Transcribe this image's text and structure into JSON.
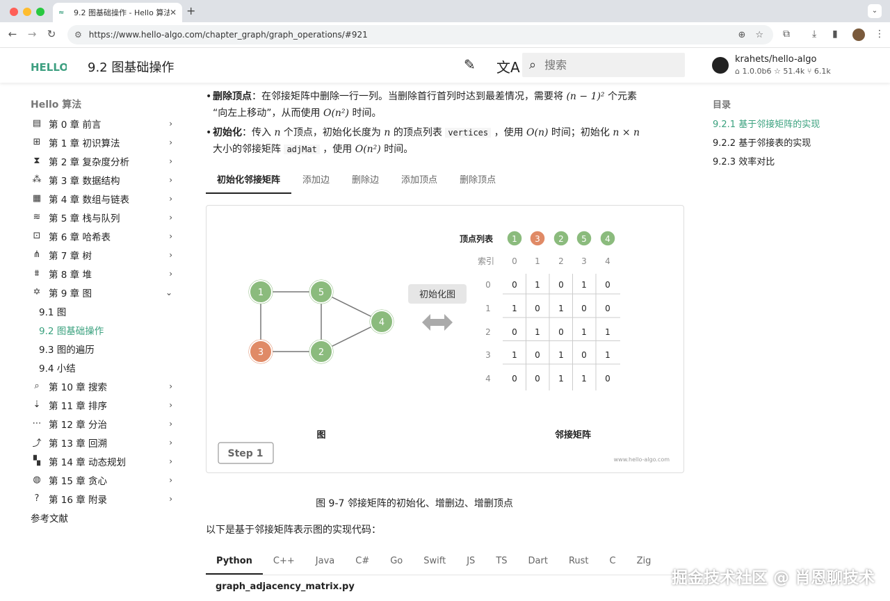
{
  "browser": {
    "tab_title": "9.2  图基础操作 - Hello 算法",
    "tab_close": "✕",
    "new_tab": "+",
    "url": "https://www.hello-algo.com/chapter_graph/graph_operations/#921"
  },
  "header": {
    "logo_text": "HELLO",
    "title": "9.2   图基础操作",
    "search_placeholder": "搜索",
    "repo_name": "krahets/hello-algo",
    "repo_version": "1.0.0b6",
    "repo_stars": "51.4k",
    "repo_forks": "6.1k"
  },
  "leftnav": {
    "heading": "Hello 算法",
    "chapters": [
      {
        "icon": "book-icon",
        "glyph": "▤",
        "label": "第 0 章   前言"
      },
      {
        "icon": "calculator-icon",
        "glyph": "⊞",
        "label": "第 1 章   初识算法"
      },
      {
        "icon": "hourglass-icon",
        "glyph": "⧗",
        "label": "第 2 章   复杂度分析"
      },
      {
        "icon": "shapes-icon",
        "glyph": "⁂",
        "label": "第 3 章   数据结构"
      },
      {
        "icon": "table-icon",
        "glyph": "▦",
        "label": "第 4 章   数组与链表"
      },
      {
        "icon": "stack-icon",
        "glyph": "≋",
        "label": "第 5 章   栈与队列"
      },
      {
        "icon": "hash-table-icon",
        "glyph": "⊡",
        "label": "第 6 章   哈希表"
      },
      {
        "icon": "tree-icon",
        "glyph": "⋔",
        "label": "第 7 章   树"
      },
      {
        "icon": "heap-icon",
        "glyph": "⩩",
        "label": "第 8 章   堆"
      },
      {
        "icon": "graph-icon",
        "glyph": "✡",
        "label": "第 9 章   图"
      }
    ],
    "sub_items": [
      "9.1   图",
      "9.2   图基础操作",
      "9.3   图的遍历",
      "9.4   小结"
    ],
    "chapters_after": [
      {
        "icon": "search-list-icon",
        "glyph": "⌕",
        "label": "第 10 章   搜索"
      },
      {
        "icon": "sort-icon",
        "glyph": "⇣",
        "label": "第 11 章   排序"
      },
      {
        "icon": "divide-icon",
        "glyph": "⋯",
        "label": "第 12 章   分治"
      },
      {
        "icon": "backtrack-icon",
        "glyph": "⤴",
        "label": "第 13 章   回溯"
      },
      {
        "icon": "grid-icon",
        "glyph": "▚",
        "label": "第 14 章   动态规划"
      },
      {
        "icon": "bulb-icon",
        "glyph": "◍",
        "label": "第 15 章   贪心"
      },
      {
        "icon": "question-icon",
        "glyph": "?",
        "label": "第 16 章   附录"
      }
    ],
    "references": "参考文献"
  },
  "toc": {
    "heading": "目录",
    "items": [
      "9.2.1   基于邻接矩阵的实现",
      "9.2.2   基于邻接表的实现",
      "9.2.3   效率对比"
    ]
  },
  "content": {
    "bullet1_label": "删除顶点",
    "bullet1_text1": "：在邻接矩阵中删除一行一列。当删除首行首列时达到最差情况，需要将 ",
    "bullet1_math1": "(n − 1)²",
    "bullet1_text2": " 个元素",
    "bullet1_text3": "“向左上移动”，从而使用 ",
    "bullet1_math2": "O(n²)",
    "bullet1_text4": " 时间。",
    "bullet2_label": "初始化",
    "bullet2_text1": "：传入 ",
    "bullet2_math1": "n",
    "bullet2_text2": " 个顶点，初始化长度为 ",
    "bullet2_math2": "n",
    "bullet2_text3": " 的顶点列表 ",
    "bullet2_code1": "vertices",
    "bullet2_text4": " ，使用 ",
    "bullet2_math3": "O(n)",
    "bullet2_text5": " 时间；初始化 ",
    "bullet2_math4": "n × n",
    "bullet2_text6": "大小的邻接矩阵 ",
    "bullet2_code2": "adjMat",
    "bullet2_text7": " ，使用 ",
    "bullet2_math5": "O(n²)",
    "bullet2_text8": " 时间。",
    "tabs": [
      "初始化邻接矩阵",
      "添加边",
      "删除边",
      "添加顶点",
      "删除顶点"
    ],
    "caption": "图 9-7    邻接矩阵的初始化、增删边、增删顶点",
    "para": "以下是基于邻接矩阵表示图的实现代码：",
    "code_tabs": [
      "Python",
      "C++",
      "Java",
      "C#",
      "Go",
      "Swift",
      "JS",
      "TS",
      "Dart",
      "Rust",
      "C",
      "Zig"
    ],
    "filename": "graph_adjacency_matrix.py"
  },
  "figure": {
    "vertex_list_label": "顶点列表",
    "index_label": "索引",
    "init_button": "初始化图",
    "graph_label": "图",
    "matrix_label": "邻接矩阵",
    "step_label": "Step 1",
    "site_mark": "www.hello-algo.com",
    "vertices": [
      "1",
      "3",
      "2",
      "5",
      "4"
    ],
    "vertex_colors": [
      "#8bbb7d",
      "#e08a66",
      "#8bbb7d",
      "#8bbb7d",
      "#8bbb7d"
    ],
    "indices": [
      "0",
      "1",
      "2",
      "3",
      "4"
    ],
    "matrix": [
      [
        "0",
        "1",
        "0",
        "1",
        "0"
      ],
      [
        "1",
        "0",
        "1",
        "0",
        "0"
      ],
      [
        "0",
        "1",
        "0",
        "1",
        "1"
      ],
      [
        "1",
        "0",
        "1",
        "0",
        "1"
      ],
      [
        "0",
        "0",
        "1",
        "1",
        "0"
      ]
    ],
    "graph_nodes": [
      {
        "label": "1",
        "color": "#8bbb7d"
      },
      {
        "label": "5",
        "color": "#8bbb7d"
      },
      {
        "label": "4",
        "color": "#8bbb7d"
      },
      {
        "label": "3",
        "color": "#e08a66"
      },
      {
        "label": "2",
        "color": "#8bbb7d"
      }
    ]
  },
  "watermark": "掘金技术社区 @ 肖恩聊技术",
  "colors": {
    "accent": "#3aa17e",
    "node_green": "#8bbb7d",
    "node_orange": "#e08a66"
  }
}
